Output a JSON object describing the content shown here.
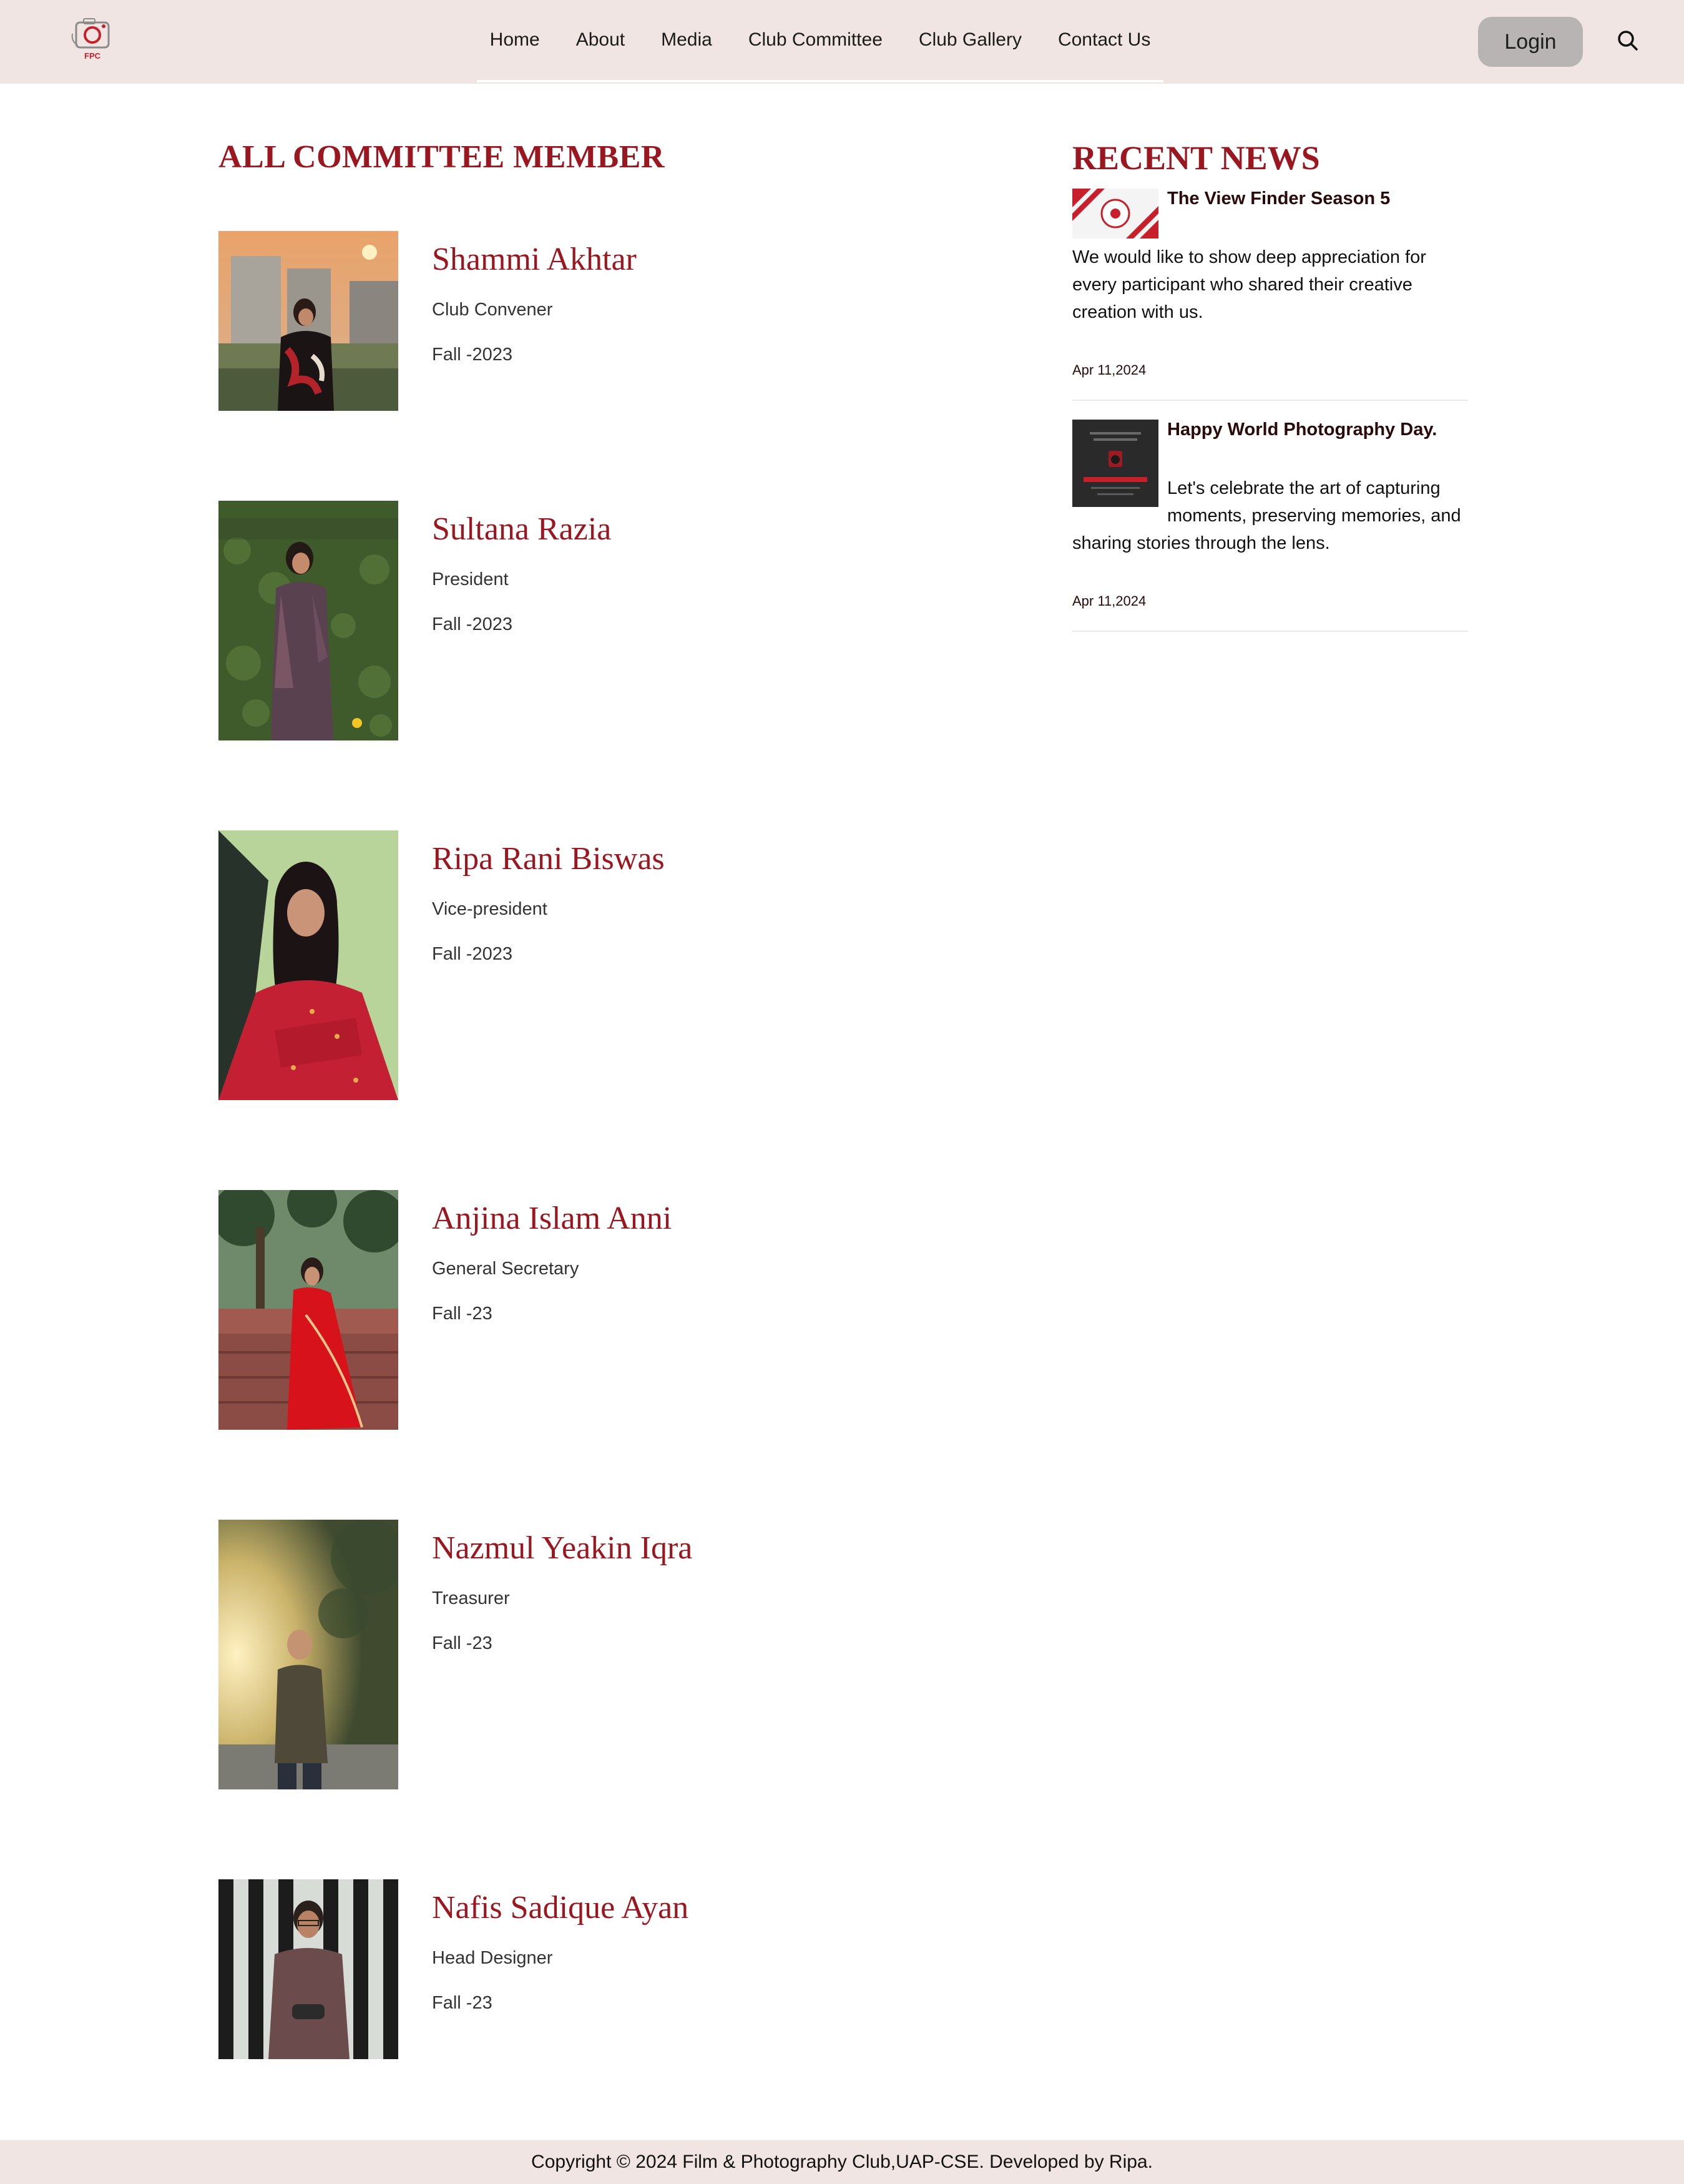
{
  "header": {
    "logo_text": "FPC",
    "nav": [
      "Home",
      "About",
      "Media",
      "Club Committee",
      "Club Gallery",
      "Contact Us"
    ],
    "login_label": "Login"
  },
  "main": {
    "title": "ALL COMMITTEE MEMBER",
    "members": [
      {
        "name": "Shammi Akhtar",
        "role": "Club Convener",
        "term": "Fall -2023"
      },
      {
        "name": "Sultana Razia",
        "role": "President",
        "term": "Fall -2023"
      },
      {
        "name": "Ripa Rani Biswas",
        "role": "Vice-president",
        "term": "Fall -2023"
      },
      {
        "name": "Anjina Islam Anni",
        "role": "General Secretary",
        "term": "Fall -23"
      },
      {
        "name": "Nazmul Yeakin Iqra",
        "role": "Treasurer",
        "term": "Fall -23"
      },
      {
        "name": "Nafis Sadique Ayan",
        "role": "Head Designer",
        "term": "Fall -23"
      }
    ]
  },
  "sidebar": {
    "title": "RECENT NEWS",
    "news": [
      {
        "headline": "The View Finder Season 5",
        "text": "We would like to show deep appreciation for every participant who shared their creative creation with us.",
        "date": "Apr 11,2024"
      },
      {
        "headline": "Happy World Photography Day.",
        "text_lines": [
          "Let's celebrate the art of capturing",
          "moments, preserving memories, and",
          "sharing stories through the lens."
        ],
        "date": "Apr 11,2024"
      }
    ]
  },
  "footer": {
    "text": "Copyright © 2024 Film & Photography Club,UAP-CSE. Developed by Ripa."
  },
  "colors": {
    "header_bg": "#f1e5e3",
    "accent_red": "#9a1720",
    "login_bg": "#b7b4b3"
  }
}
